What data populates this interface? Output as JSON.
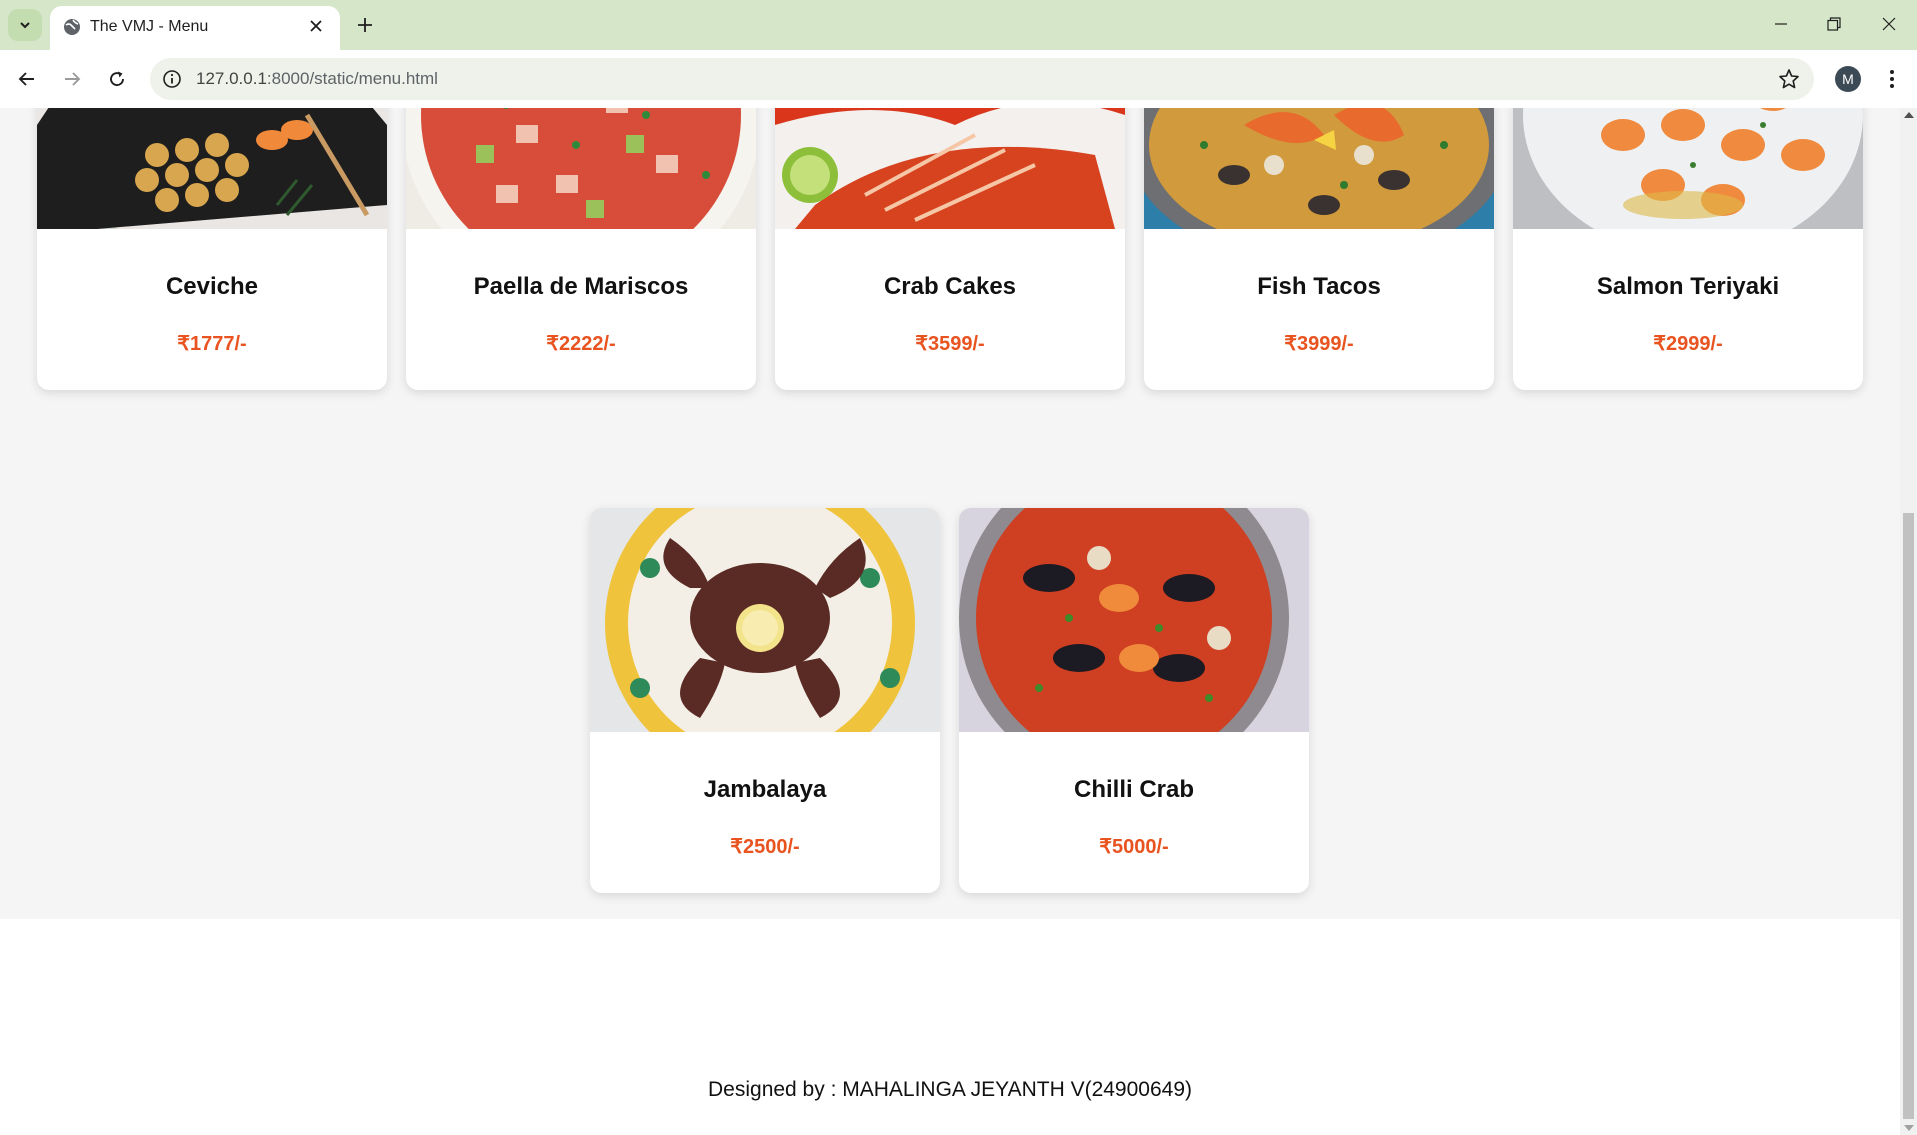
{
  "browser": {
    "tab_title": "The VMJ - Menu",
    "url_host": "127.0.0.1",
    "url_rest": ":8000/static/menu.html",
    "profile_initial": "M",
    "icons": [
      "chevron-down-icon",
      "globe-icon",
      "close-icon",
      "plus-icon",
      "minimize-icon",
      "restore-icon",
      "close-window-icon",
      "back-icon",
      "forward-icon",
      "reload-icon",
      "info-icon",
      "star-icon",
      "kebab-menu-icon"
    ]
  },
  "menu": {
    "items": [
      {
        "name": "Ceviche",
        "price": "₹1777/-",
        "image": "sushi-platter-photo"
      },
      {
        "name": "Paella de Mariscos",
        "price": "₹2222/-",
        "image": "ceviche-bowl-photo"
      },
      {
        "name": "Crab Cakes",
        "price": "₹3599/-",
        "image": "lobster-photo"
      },
      {
        "name": "Fish Tacos",
        "price": "₹3999/-",
        "image": "seafood-paella-photo"
      },
      {
        "name": "Salmon Teriyaki",
        "price": "₹2999/-",
        "image": "garlic-shrimp-photo"
      },
      {
        "name": "Jambalaya",
        "price": "₹2500/-",
        "image": "grilled-octopus-photo"
      },
      {
        "name": "Chilli Crab",
        "price": "₹5000/-",
        "image": "seafood-stew-photo"
      }
    ],
    "price_color": "#e8531f"
  },
  "footer": {
    "text": "Designed by : MAHALINGA JEYANTH V(24900649)"
  }
}
